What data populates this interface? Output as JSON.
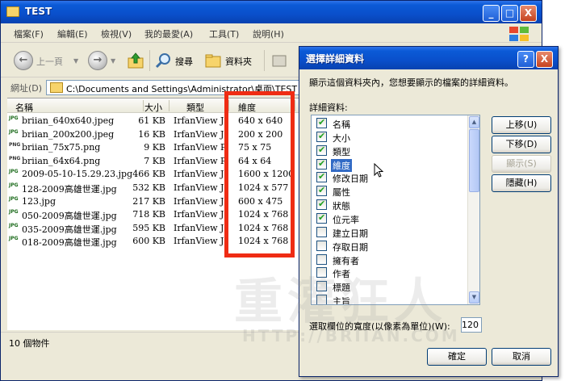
{
  "window": {
    "title": "TEST",
    "minimize": "_",
    "maximize": "□",
    "close": "X"
  },
  "menu": [
    "檔案(F)",
    "編輯(E)",
    "檢視(V)",
    "我的最愛(A)",
    "工具(T)",
    "說明(H)"
  ],
  "toolbar": {
    "back": "上一頁",
    "search": "搜尋",
    "folders": "資料夾"
  },
  "address": {
    "label": "網址(D)",
    "path": "C:\\Documents and Settings\\Administrator\\桌面\\TEST"
  },
  "columns": {
    "name": "名稱",
    "size": "大小",
    "type": "類型",
    "dimensions": "維度"
  },
  "files": [
    {
      "icon": "JPG",
      "name": "briian_640x640.jpeg",
      "size": "61 KB",
      "type": "IrfanView JP...",
      "dim": "640 x 640"
    },
    {
      "icon": "JPG",
      "name": "briian_200x200.jpeg",
      "size": "16 KB",
      "type": "IrfanView JP...",
      "dim": "200 x 200"
    },
    {
      "icon": "PNG",
      "name": "briian_75x75.png",
      "size": "9 KB",
      "type": "IrfanView P...",
      "dim": "75 x 75"
    },
    {
      "icon": "PNG",
      "name": "briian_64x64.png",
      "size": "7 KB",
      "type": "IrfanView P...",
      "dim": "64 x 64"
    },
    {
      "icon": "JPG",
      "name": "2009-05-10-15.29.23.jpg",
      "size": "466 KB",
      "type": "IrfanView JP...",
      "dim": "1600 x 1200"
    },
    {
      "icon": "JPG",
      "name": "128-2009高雄世運.jpg",
      "size": "532 KB",
      "type": "IrfanView JP...",
      "dim": "1024 x 577"
    },
    {
      "icon": "JPG",
      "name": "123.jpg",
      "size": "217 KB",
      "type": "IrfanView JP...",
      "dim": "600 x 475"
    },
    {
      "icon": "JPG",
      "name": "050-2009高雄世運.jpg",
      "size": "718 KB",
      "type": "IrfanView JP...",
      "dim": "1024 x 768"
    },
    {
      "icon": "JPG",
      "name": "035-2009高雄世運.jpg",
      "size": "595 KB",
      "type": "IrfanView JP...",
      "dim": "1024 x 768"
    },
    {
      "icon": "JPG",
      "name": "018-2009高雄世運.jpg",
      "size": "600 KB",
      "type": "IrfanView JP...",
      "dim": "1024 x 768"
    }
  ],
  "status": "10 個物件",
  "dialog": {
    "title": "選擇詳細資料",
    "help": "?",
    "close": "X",
    "description": "顯示這個資料夾內，您想要顯示的檔案的詳細資料。",
    "subheading": "詳細資料:",
    "items": [
      {
        "label": "名稱",
        "checked": true
      },
      {
        "label": "大小",
        "checked": true
      },
      {
        "label": "類型",
        "checked": true
      },
      {
        "label": "維度",
        "checked": true,
        "selected": true
      },
      {
        "label": "修改日期",
        "checked": true
      },
      {
        "label": "屬性",
        "checked": true
      },
      {
        "label": "狀態",
        "checked": true
      },
      {
        "label": "位元率",
        "checked": true
      },
      {
        "label": "建立日期",
        "checked": false
      },
      {
        "label": "存取日期",
        "checked": false
      },
      {
        "label": "擁有者",
        "checked": false
      },
      {
        "label": "作者",
        "checked": false
      },
      {
        "label": "標題",
        "checked": false
      },
      {
        "label": "主旨",
        "checked": false
      }
    ],
    "buttons": {
      "move_up": "上移(U)",
      "move_down": "下移(D)",
      "show": "顯示(S)",
      "hide": "隱藏(H)",
      "ok": "確定",
      "cancel": "取消"
    },
    "width_label": "選取欄位的寬度(以像素為單位)(W):",
    "width_value": "120"
  },
  "watermark": {
    "main": "重灌狂人",
    "sub": "HTTP://BRIIAN.COM"
  },
  "colors": {
    "titlebar": "#0a4fcb",
    "highlight_box": "#ef2c14",
    "selection": "#316ac5"
  }
}
